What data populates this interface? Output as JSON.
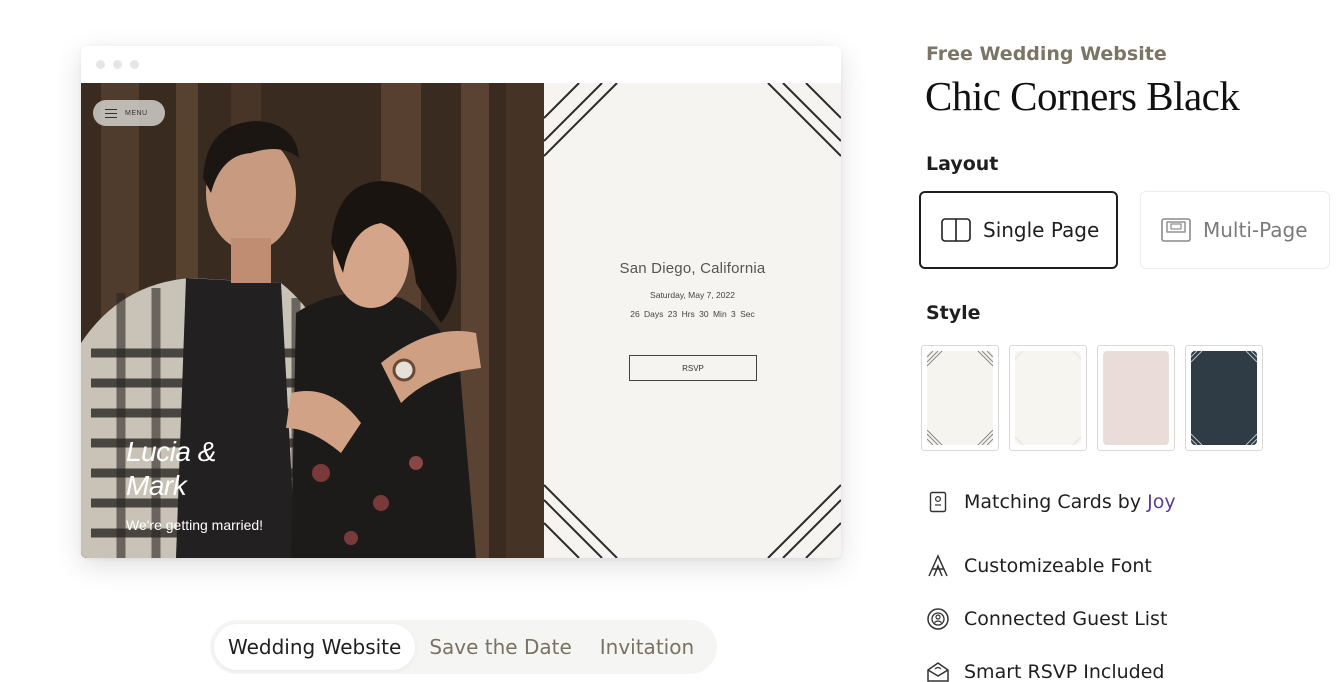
{
  "preview": {
    "menu_label": "MENU",
    "couple_name_line1": "Lucia &",
    "couple_name_line2": "Mark",
    "tagline": "We're getting married!",
    "location": "San Diego, California",
    "date": "Saturday, May 7, 2022",
    "countdown": "26 Days   23 Hrs  30 Min   3 Sec",
    "rsvp_label": "RSVP"
  },
  "preview_tabs": [
    {
      "label": "Wedding Website",
      "active": true
    },
    {
      "label": "Save the Date",
      "active": false
    },
    {
      "label": "Invitation",
      "active": false
    }
  ],
  "details": {
    "eyebrow": "Free Wedding Website",
    "title": "Chic Corners Black",
    "layout_heading": "Layout",
    "layout_options": [
      {
        "label": "Single Page",
        "selected": true,
        "icon": "single-page-icon"
      },
      {
        "label": "Multi-Page",
        "selected": false,
        "icon": "multi-page-icon"
      }
    ],
    "style_heading": "Style",
    "style_swatches": [
      {
        "name": "ivory-corners",
        "color": "#f6f4ee",
        "selected": true
      },
      {
        "name": "ivory-plain",
        "color": "#f7f5f0",
        "selected": false
      },
      {
        "name": "blush",
        "color": "#e9dcd9",
        "selected": false
      },
      {
        "name": "slate",
        "color": "#2f3c45",
        "selected": false
      }
    ],
    "features": [
      {
        "icon": "card-icon",
        "label": "Matching Cards by ",
        "link": "Joy"
      },
      {
        "icon": "font-icon",
        "label": "Customizeable Font"
      },
      {
        "icon": "guest-list-icon",
        "label": "Connected Guest List"
      },
      {
        "icon": "envelope-icon",
        "label": "Smart RSVP Included"
      }
    ]
  },
  "colors": {
    "accent_link": "#5b3b9a",
    "eyebrow": "#7b7565",
    "info_panel_bg": "#f6f4f0"
  }
}
